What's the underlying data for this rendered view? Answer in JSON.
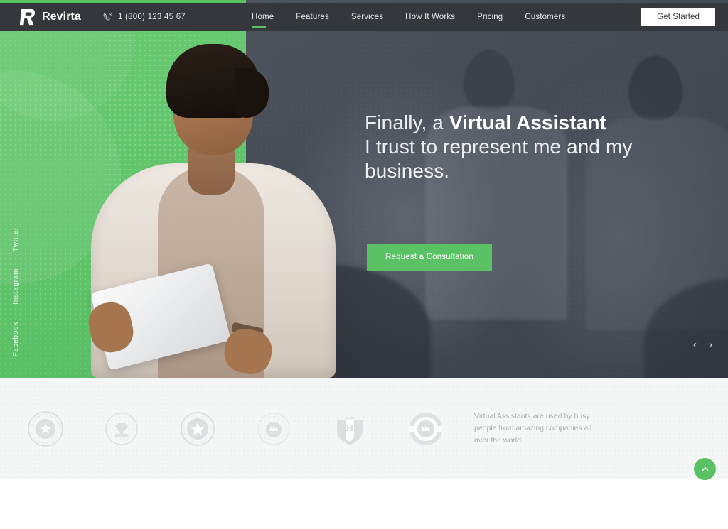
{
  "header": {
    "logo_icon": "revirta-r-logo-icon",
    "brand": "Revirta",
    "phone_icon": "phone-icon",
    "phone": "1 (800) 123 45 67",
    "nav": [
      {
        "label": "Home",
        "active": true
      },
      {
        "label": "Features",
        "active": false
      },
      {
        "label": "Services",
        "active": false
      },
      {
        "label": "How It Works",
        "active": false
      },
      {
        "label": "Pricing",
        "active": false
      },
      {
        "label": "Customers",
        "active": false
      }
    ],
    "cta_label": "Get Started"
  },
  "social": {
    "items": [
      "Twitter",
      "Instagram",
      "Facebook"
    ]
  },
  "hero": {
    "heading_lead": "Finally, a ",
    "heading_strong": "Virtual Assistant",
    "heading_rest": "I trust to represent me and my business.",
    "cta_label": "Request a Consultation",
    "prev_icon": "chevron-left-icon",
    "next_icon": "chevron-right-icon"
  },
  "clients": {
    "badges": [
      "badge-rosette-icon",
      "badge-diamond-icon",
      "badge-star-icon",
      "badge-laurel-crown-icon",
      "badge-shield-h-icon",
      "badge-crown-ribbon-icon"
    ],
    "note": "Virtual Assistants are used by busy people from amazing companies all over the world."
  },
  "scroll_top": {
    "icon": "chevron-up-icon"
  },
  "colors": {
    "accent_green": "#5ac264",
    "header_dark": "#34373c",
    "clients_bg": "#f5f7f7",
    "hero_text": "#eceef0"
  }
}
